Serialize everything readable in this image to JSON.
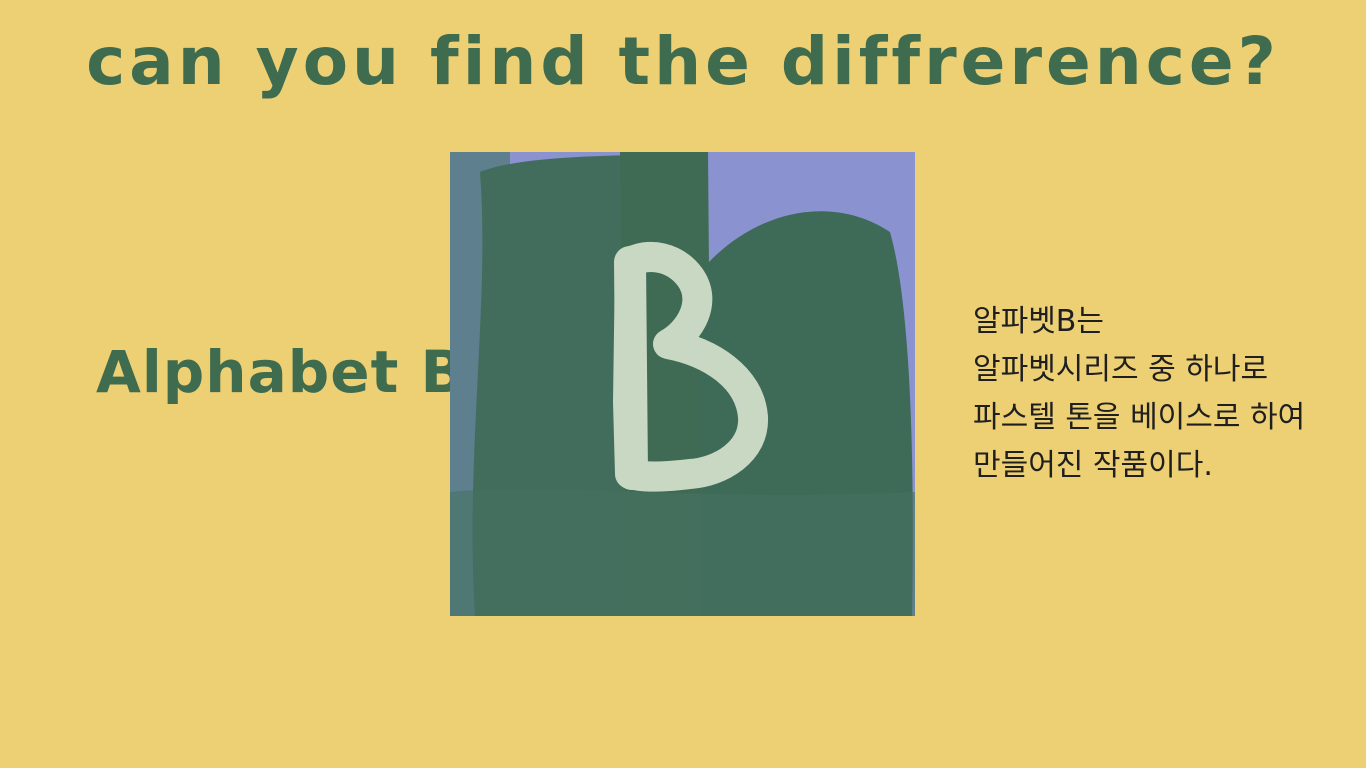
{
  "slide": {
    "title": "can you find the diffrerence?",
    "subtitle": "Alphabet B",
    "artwork": {
      "letter": "B",
      "colors": {
        "background_blue": "#8a93cf",
        "brush_green": "#3f6b58",
        "letter_fill": "#c9d8c2"
      }
    },
    "description": [
      "알파벳B는",
      "알파벳시리즈 중 하나로",
      "파스텔 톤을 베이스로 하여",
      "만들어진 작품이다."
    ]
  }
}
